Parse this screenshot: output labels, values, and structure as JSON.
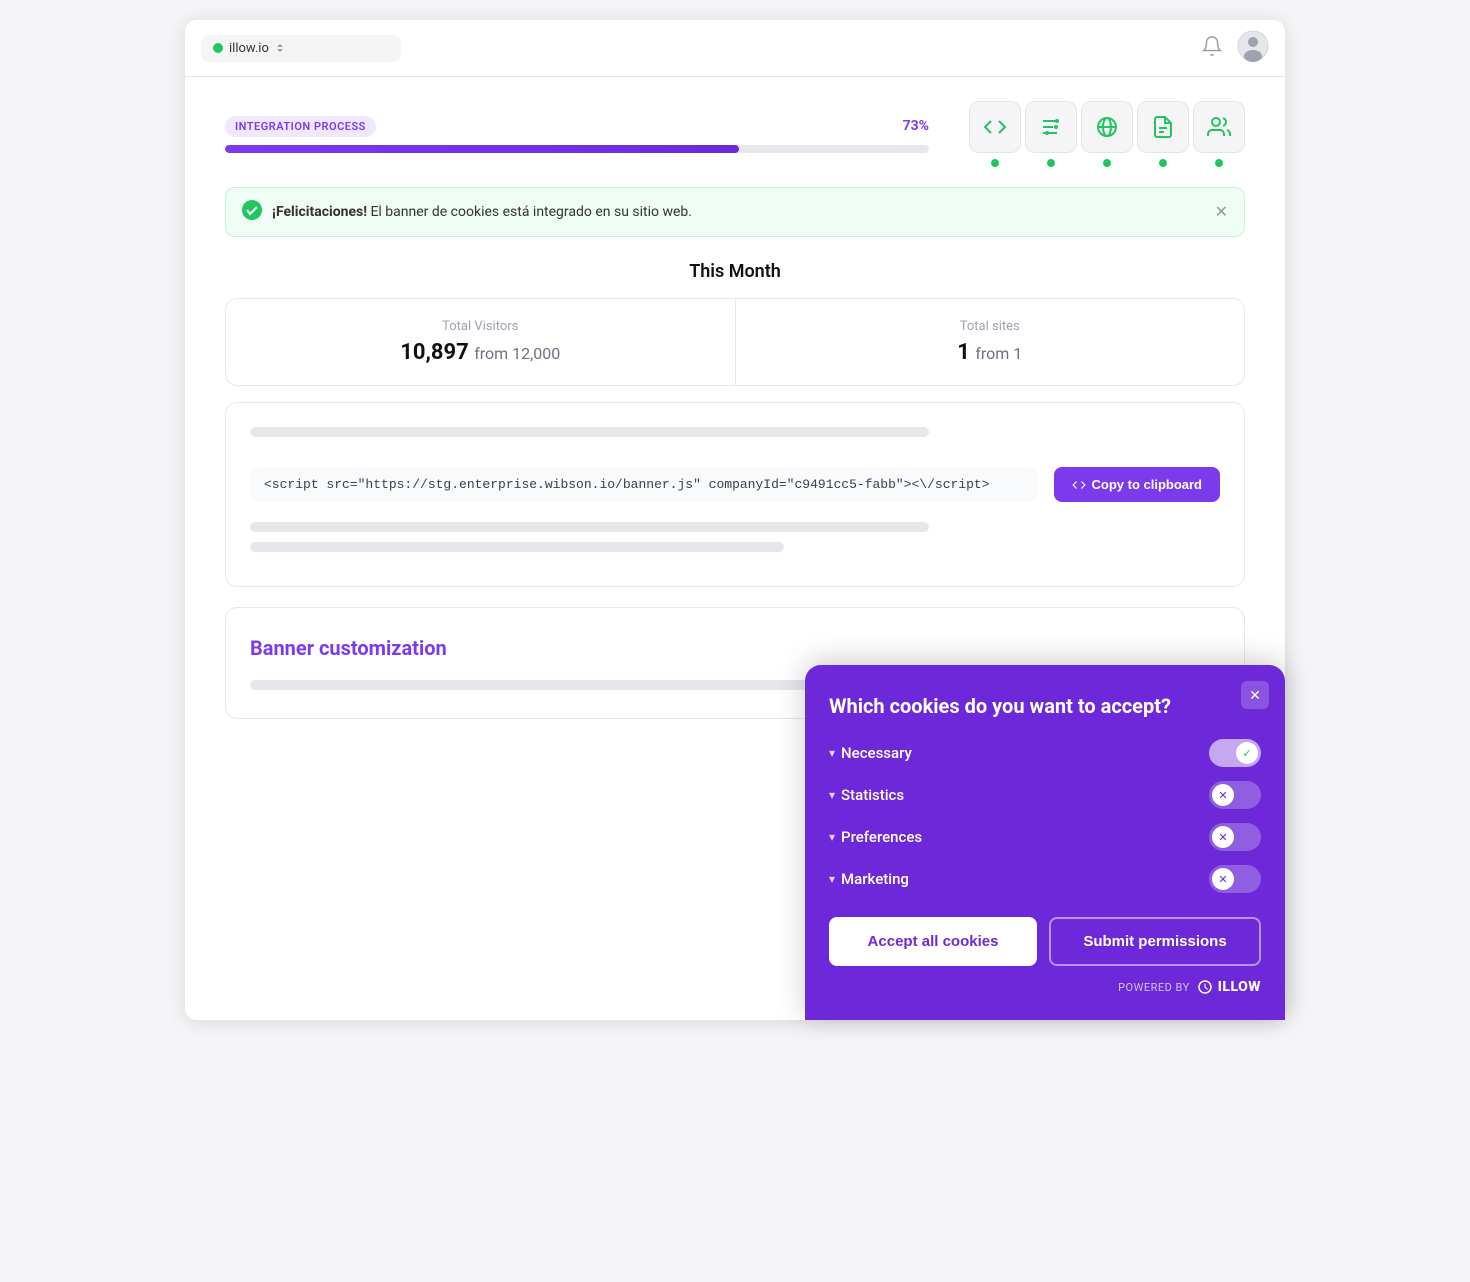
{
  "browser": {
    "url": "illow.io",
    "dot_color": "#22c55e"
  },
  "integration": {
    "badge_label": "INTEGRATION PROCESS",
    "percent_label": "73%",
    "percent_value": 73,
    "steps": [
      {
        "icon": "</>",
        "label": "code"
      },
      {
        "icon": "⚙",
        "label": "settings"
      },
      {
        "icon": "🌐",
        "label": "globe"
      },
      {
        "icon": "📄",
        "label": "document"
      },
      {
        "icon": "👥",
        "label": "users"
      }
    ]
  },
  "success_banner": {
    "bold": "¡Felicitaciones!",
    "text": " El banner de cookies está integrado en su sitio web."
  },
  "this_month": {
    "title": "This Month",
    "visitors": {
      "label": "Total Visitors",
      "value": "10,897",
      "from": "from 12,000"
    },
    "sites": {
      "label": "Total sites",
      "value": "1",
      "from": "from 1"
    }
  },
  "script_section": {
    "code": "<script src=\"https://stg.enterprise.wibson.io/banner.js\" companyId=\"c9491cc5-fabb\"><\\/script>",
    "copy_button": "Copy to clipboard"
  },
  "banner_section": {
    "title": "Banner customization"
  },
  "cookie_popup": {
    "title": "Which cookies do you want to accept?",
    "close_label": "×",
    "categories": [
      {
        "label": "Necessary",
        "enabled": true
      },
      {
        "label": "Statistics",
        "enabled": false
      },
      {
        "label": "Preferences",
        "enabled": false
      },
      {
        "label": "Marketing",
        "enabled": false
      }
    ],
    "accept_all_label": "Accept all cookies",
    "submit_label": "Submit permissions",
    "powered_by_prefix": "POWERED BY",
    "brand_name": "illow"
  }
}
